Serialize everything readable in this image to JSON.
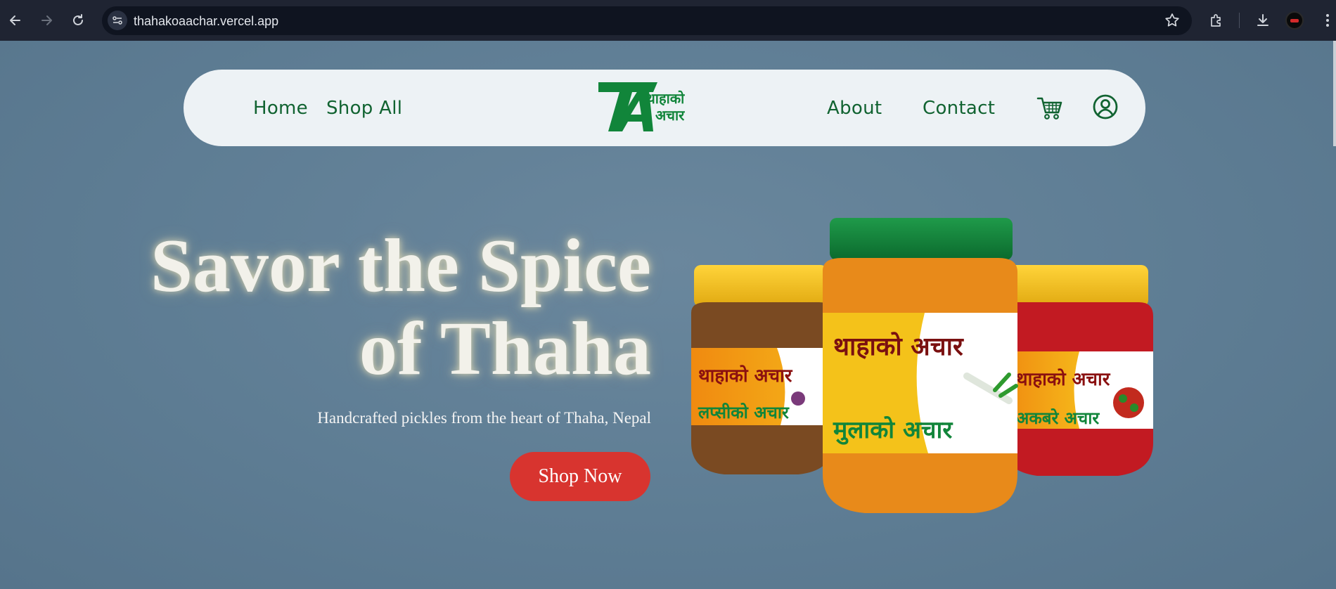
{
  "browser": {
    "url": "thahakoaachar.vercel.app"
  },
  "nav": {
    "home": "Home",
    "shop_all": "Shop All",
    "about": "About",
    "contact": "Contact",
    "logo_text_line1": "थाहाको",
    "logo_text_line2": "अचार"
  },
  "hero": {
    "title_line1": "Savor the Spice",
    "title_line2": "of Thaha",
    "subtitle": "Handcrafted pickles from the heart of Thaha, Nepal",
    "cta": "Shop Now"
  },
  "products": {
    "brand": "थाहाको अचार",
    "left_jar_label": "लप्सीको अचार",
    "center_jar_label": "मुलाको अचार",
    "right_jar_label": "अकबरे अचार"
  },
  "colors": {
    "brand_green": "#116331",
    "cta_red": "#d8342f",
    "page_bg": "#5f7f97"
  },
  "icons": [
    "back-icon",
    "forward-icon",
    "reload-icon",
    "site-info-icon",
    "bookmark-star-icon",
    "extensions-icon",
    "download-icon",
    "cart-icon",
    "user-icon"
  ]
}
